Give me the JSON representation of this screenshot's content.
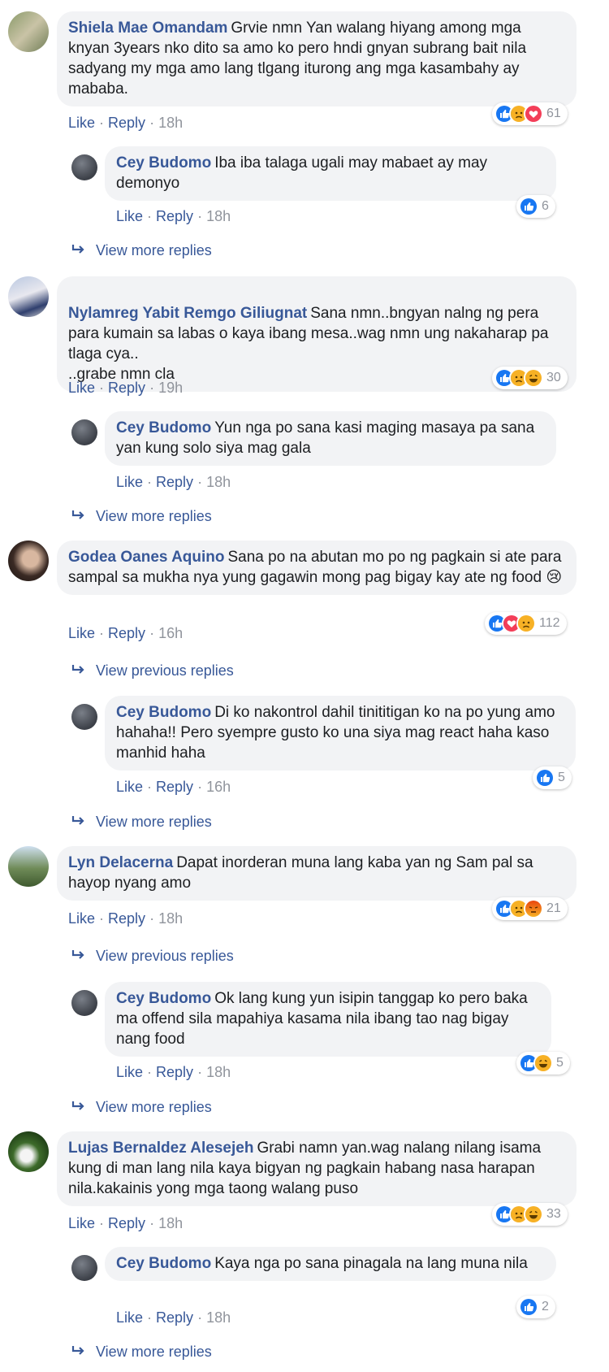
{
  "threads": [
    {
      "comment": {
        "author": "Shiela Mae Omandam",
        "text": "Grvie nmn Yan walang hiyang among mga knyan 3years nko dito sa amo ko pero hndi gnyan subrang bait nila sadyang my mga amo lang tlgang iturong ang mga kasambahy ay mababa.",
        "like": "Like",
        "reply": "Reply",
        "time": "18h",
        "reaction_count": "61",
        "reactions": [
          "like",
          "sad",
          "love"
        ]
      },
      "reply": {
        "author": "Cey Budomo",
        "text": "Iba iba talaga ugali may mabaet ay may demonyo",
        "like": "Like",
        "reply": "Reply",
        "time": "18h",
        "reaction_count": "6",
        "reactions": [
          "like"
        ]
      },
      "more": "View more replies"
    },
    {
      "comment": {
        "author": "Nylamreg Yabit Remgo Giliugnat",
        "text": "Sana nmn..bngyan nalng ng pera para kumain sa labas o kaya ibang mesa..wag nmn ung nakaharap pa tlaga cya..\n..grabe nmn cla",
        "like": "Like",
        "reply": "Reply",
        "time": "19h",
        "reaction_count": "30",
        "reactions": [
          "like",
          "sad",
          "haha"
        ]
      },
      "reply": {
        "author": "Cey Budomo",
        "text": "Yun nga po sana kasi maging masaya pa sana yan kung solo siya mag gala",
        "like": "Like",
        "reply": "Reply",
        "time": "18h"
      },
      "more": "View more replies"
    },
    {
      "comment": {
        "author": "Godea Oanes Aquino",
        "text": "Sana po na abutan mo po ng pagkain si ate para sampal sa mukha nya yung gagawin mong pag bigay kay ate ng food 😢",
        "like": "Like",
        "reply": "Reply",
        "time": "16h",
        "reaction_count": "112",
        "reactions": [
          "like",
          "love",
          "sad"
        ]
      },
      "previous": "View previous replies",
      "reply": {
        "author": "Cey Budomo",
        "text": "Di ko nakontrol dahil tinititigan ko na po yung amo hahaha!! Pero syempre gusto ko una siya mag react haha kaso manhid haha",
        "like": "Like",
        "reply": "Reply",
        "time": "16h",
        "reaction_count": "5",
        "reactions": [
          "like"
        ]
      },
      "more": "View more replies"
    },
    {
      "comment": {
        "author": "Lyn Delacerna",
        "text": "Dapat inorderan muna lang kaba yan ng Sam pal sa hayop nyang amo",
        "like": "Like",
        "reply": "Reply",
        "time": "18h",
        "reaction_count": "21",
        "reactions": [
          "like",
          "sad",
          "angry"
        ]
      },
      "previous": "View previous replies",
      "reply": {
        "author": "Cey Budomo",
        "text": "Ok lang kung yun isipin tanggap ko pero baka ma offend sila mapahiya kasama nila ibang tao nag bigay nang food",
        "like": "Like",
        "reply": "Reply",
        "time": "18h",
        "reaction_count": "5",
        "reactions": [
          "like",
          "haha"
        ]
      },
      "more": "View more replies"
    },
    {
      "comment": {
        "author": "Lujas Bernaldez Alesejeh",
        "text": "Grabi namn yan.wag nalang nilang isama kung di man lang nila kaya bigyan ng pagkain habang nasa harapan nila.kakainis yong mga taong walang puso",
        "like": "Like",
        "reply": "Reply",
        "time": "18h",
        "reaction_count": "33",
        "reactions": [
          "like",
          "sad",
          "haha"
        ]
      },
      "reply": {
        "author": "Cey Budomo",
        "text": "Kaya nga po sana pinagala na lang muna nila",
        "like": "Like",
        "reply": "Reply",
        "time": "18h",
        "reaction_count": "2",
        "reactions": [
          "like"
        ]
      },
      "more": "View more replies"
    }
  ],
  "colors": {
    "link": "#385898",
    "bubble": "#f2f3f5",
    "meta": "#90949c",
    "like": "#1877f2",
    "love": "#f33e58",
    "sad": "#f7b125",
    "angry": "#e9710f"
  }
}
